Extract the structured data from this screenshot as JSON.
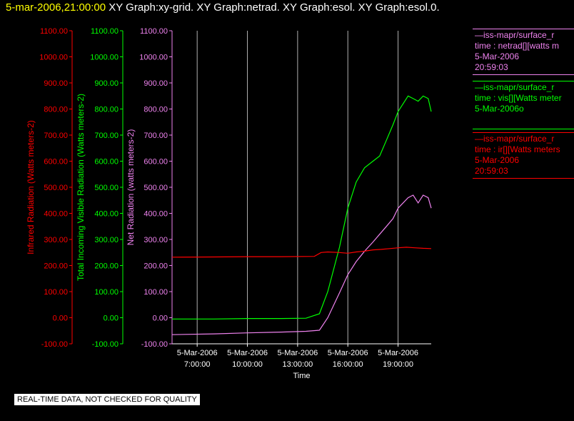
{
  "header": {
    "datetime": "5-mar-2006,21:00:00",
    "titles": [
      "XY Graph:xy-grid.",
      "XY Graph:netrad.",
      "XY Graph:esol.",
      "XY Graph:esol.0."
    ]
  },
  "notice": "REAL-TIME DATA, NOT CHECKED FOR QUALITY",
  "legend": [
    {
      "name_line": "—iss-mapr/surface_r",
      "var_line": "time : netrad[][watts m",
      "date_line": "5-Mar-2006",
      "time_line": "20:59:03",
      "color": "#ee82ee"
    },
    {
      "name_line": "—iss-mapr/surface_r",
      "var_line": "time : vis[][Watts meter",
      "date_line": "5-Mar-2006o",
      "time_line": "",
      "color": "#00ff00"
    },
    {
      "name_line": "—iss-mapr/surface_r",
      "var_line": "time : ir[][Watts meters",
      "date_line": "5-Mar-2006",
      "time_line": "20:59:03",
      "color": "#ff0000"
    }
  ],
  "chart_data": {
    "type": "line",
    "xlabel": "Time",
    "x_ticks": [
      {
        "date": "5-Mar-2006",
        "time": "7:00:00",
        "hour": 7
      },
      {
        "date": "5-Mar-2006",
        "time": "10:00:00",
        "hour": 10
      },
      {
        "date": "5-Mar-2006",
        "time": "13:00:00",
        "hour": 13
      },
      {
        "date": "5-Mar-2006",
        "time": "16:00:00",
        "hour": 16
      },
      {
        "date": "5-Mar-2006",
        "time": "19:00:00",
        "hour": 19
      }
    ],
    "xlim": [
      5.5,
      20.98
    ],
    "ylim": [
      -100,
      1100
    ],
    "y_ticks": [
      "-100.00",
      "0.00",
      "100.00",
      "200.00",
      "300.00",
      "400.00",
      "500.00",
      "600.00",
      "700.00",
      "800.00",
      "900.00",
      "1000.00",
      "1100.00"
    ],
    "y_axes": [
      {
        "label": "Infrared Radiation (Watts meters-2)",
        "color": "#ff0000"
      },
      {
        "label": "Total Incoming Visible Radiation (Watts meters-2)",
        "color": "#00ff00"
      },
      {
        "label": "Net Radiation (watts meters-2)",
        "color": "#ee82ee"
      }
    ],
    "grid": "vertical",
    "series": [
      {
        "name": "time : netrad[][watts m",
        "color": "#ee82ee",
        "x": [
          5.5,
          8.0,
          10.0,
          12.0,
          13.5,
          14.3,
          14.8,
          15.5,
          16.0,
          16.5,
          17.0,
          17.5,
          17.9,
          18.3,
          18.7,
          19.0,
          19.3,
          19.6,
          19.9,
          20.2,
          20.5,
          20.8,
          20.98
        ],
        "y": [
          -65,
          -62,
          -58,
          -55,
          -52,
          -48,
          0,
          95,
          165,
          215,
          255,
          290,
          320,
          350,
          380,
          420,
          440,
          460,
          470,
          440,
          470,
          460,
          420
        ]
      },
      {
        "name": "time : vis[][Watts meter",
        "color": "#00ff00",
        "x": [
          5.5,
          8.0,
          10.0,
          12.0,
          13.5,
          14.3,
          14.8,
          15.5,
          16.0,
          16.5,
          17.0,
          17.5,
          17.9,
          18.3,
          18.7,
          19.0,
          19.3,
          19.6,
          19.9,
          20.2,
          20.5,
          20.8,
          20.98
        ],
        "y": [
          -5,
          -5,
          -3,
          -3,
          -2,
          15,
          100,
          270,
          420,
          520,
          575,
          600,
          620,
          680,
          740,
          790,
          820,
          850,
          840,
          830,
          850,
          840,
          790
        ]
      },
      {
        "name": "time : ir[][Watts meters",
        "color": "#ff0000",
        "x": [
          5.5,
          8.0,
          10.0,
          12.0,
          14.0,
          14.4,
          14.8,
          15.5,
          16.0,
          16.5,
          17.0,
          17.5,
          18.0,
          18.5,
          19.0,
          19.5,
          20.0,
          20.5,
          20.98
        ],
        "y": [
          232,
          233,
          234,
          234,
          235,
          250,
          252,
          250,
          247,
          252,
          255,
          260,
          262,
          265,
          268,
          270,
          268,
          266,
          265
        ]
      }
    ]
  }
}
